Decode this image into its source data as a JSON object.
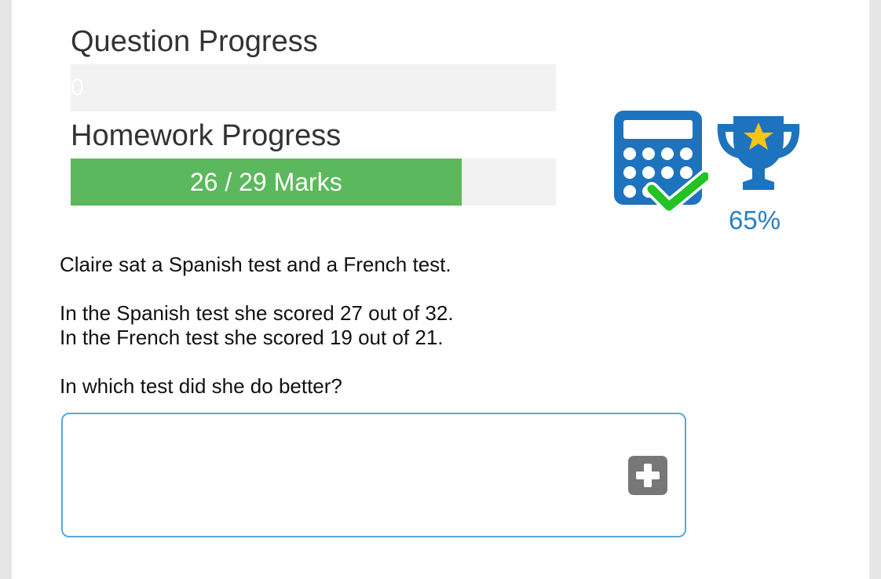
{
  "question_progress": {
    "label": "Question Progress",
    "bar_text": "0",
    "fraction": 0
  },
  "homework_progress": {
    "label": "Homework Progress",
    "bar_text": "26 / 29 Marks",
    "marks_earned": 26,
    "marks_total": 29
  },
  "tools": {
    "calculator_icon": "calculator-allowed-icon",
    "trophy_icon": "trophy-icon",
    "score": "65%"
  },
  "question": {
    "lines": [
      "Claire sat a Spanish test and a French test.",
      "In the Spanish test she scored 27 out of 32.",
      "In the French test she scored 19 out of 21.",
      "In which test did she do better?"
    ]
  },
  "answer": {
    "value": "",
    "add_icon": "plus-icon"
  },
  "colors": {
    "progress_fill": "#5cb85c",
    "progress_track": "#f2f2f2",
    "icon_blue": "#1e73be",
    "check_green": "#22c322",
    "star_gold": "#f5c518",
    "input_border": "#5ba6dd"
  }
}
